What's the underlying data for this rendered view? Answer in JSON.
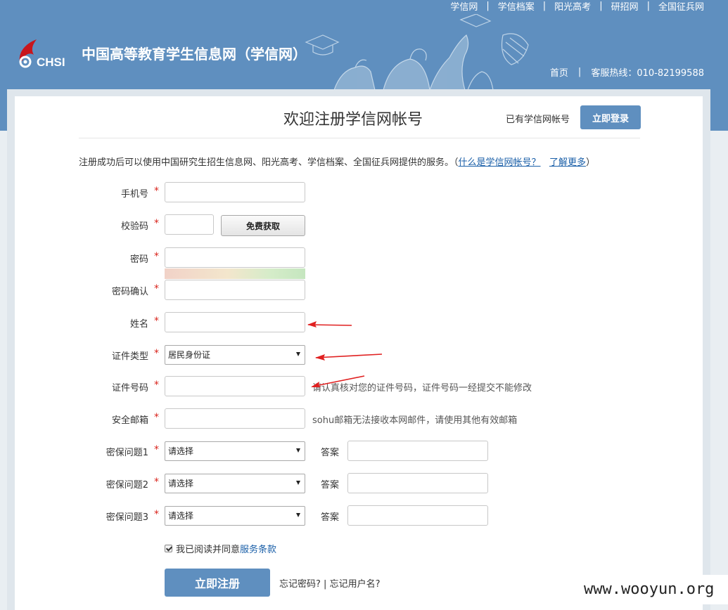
{
  "top_nav": {
    "links": [
      "学信网",
      "阳光高考",
      "研招网",
      "全国征兵网"
    ],
    "item_archive": "学信档案",
    "separator": "|"
  },
  "logo": {
    "mark_text": "CHSI",
    "site_name": "中国高等教育学生信息网（学信网）"
  },
  "header_right": {
    "home": "首页",
    "separator": "|",
    "hotline": "客服热线：010-82199588"
  },
  "page": {
    "title": "欢迎注册学信网帐号",
    "have_account": "已有学信网帐号",
    "login_button": "立即登录",
    "intro_prefix": "注册成功后可以使用中国研究生招生信息网、阳光高考、学信档案、全国征兵网提供的服务。（",
    "intro_link1": "什么是学信网帐号？",
    "intro_link2": "了解更多",
    "intro_suffix": "）"
  },
  "form": {
    "required_mark": "*",
    "phone_label": "手机号",
    "code_label": "校验码",
    "code_button": "免费获取",
    "password_label": "密码",
    "password_confirm_label": "密码确认",
    "name_label": "姓名",
    "id_type_label": "证件类型",
    "id_type_value": "居民身份证",
    "id_number_label": "证件号码",
    "id_number_hint": "请认真核对您的证件号码，证件号码一经提交不能修改",
    "email_label": "安全邮箱",
    "email_hint": "sohu邮箱无法接收本网邮件，请使用其他有效邮箱",
    "question1_label": "密保问题1",
    "question2_label": "密保问题2",
    "question3_label": "密保问题3",
    "question_placeholder": "请选择",
    "answer_label": "答案",
    "agree_text": "我已阅读并同意",
    "agree_link": "服务条款",
    "register_button": "立即注册",
    "forgot_password": "忘记密码?",
    "forgot_separator": "|",
    "forgot_username": "忘记用户名?"
  },
  "watermark": "www.wooyun.org",
  "colors": {
    "brand_blue": "#5f8fbf",
    "required_red": "#d9241c",
    "link_blue": "#1a5fa8",
    "annotation_red": "#e02020"
  }
}
